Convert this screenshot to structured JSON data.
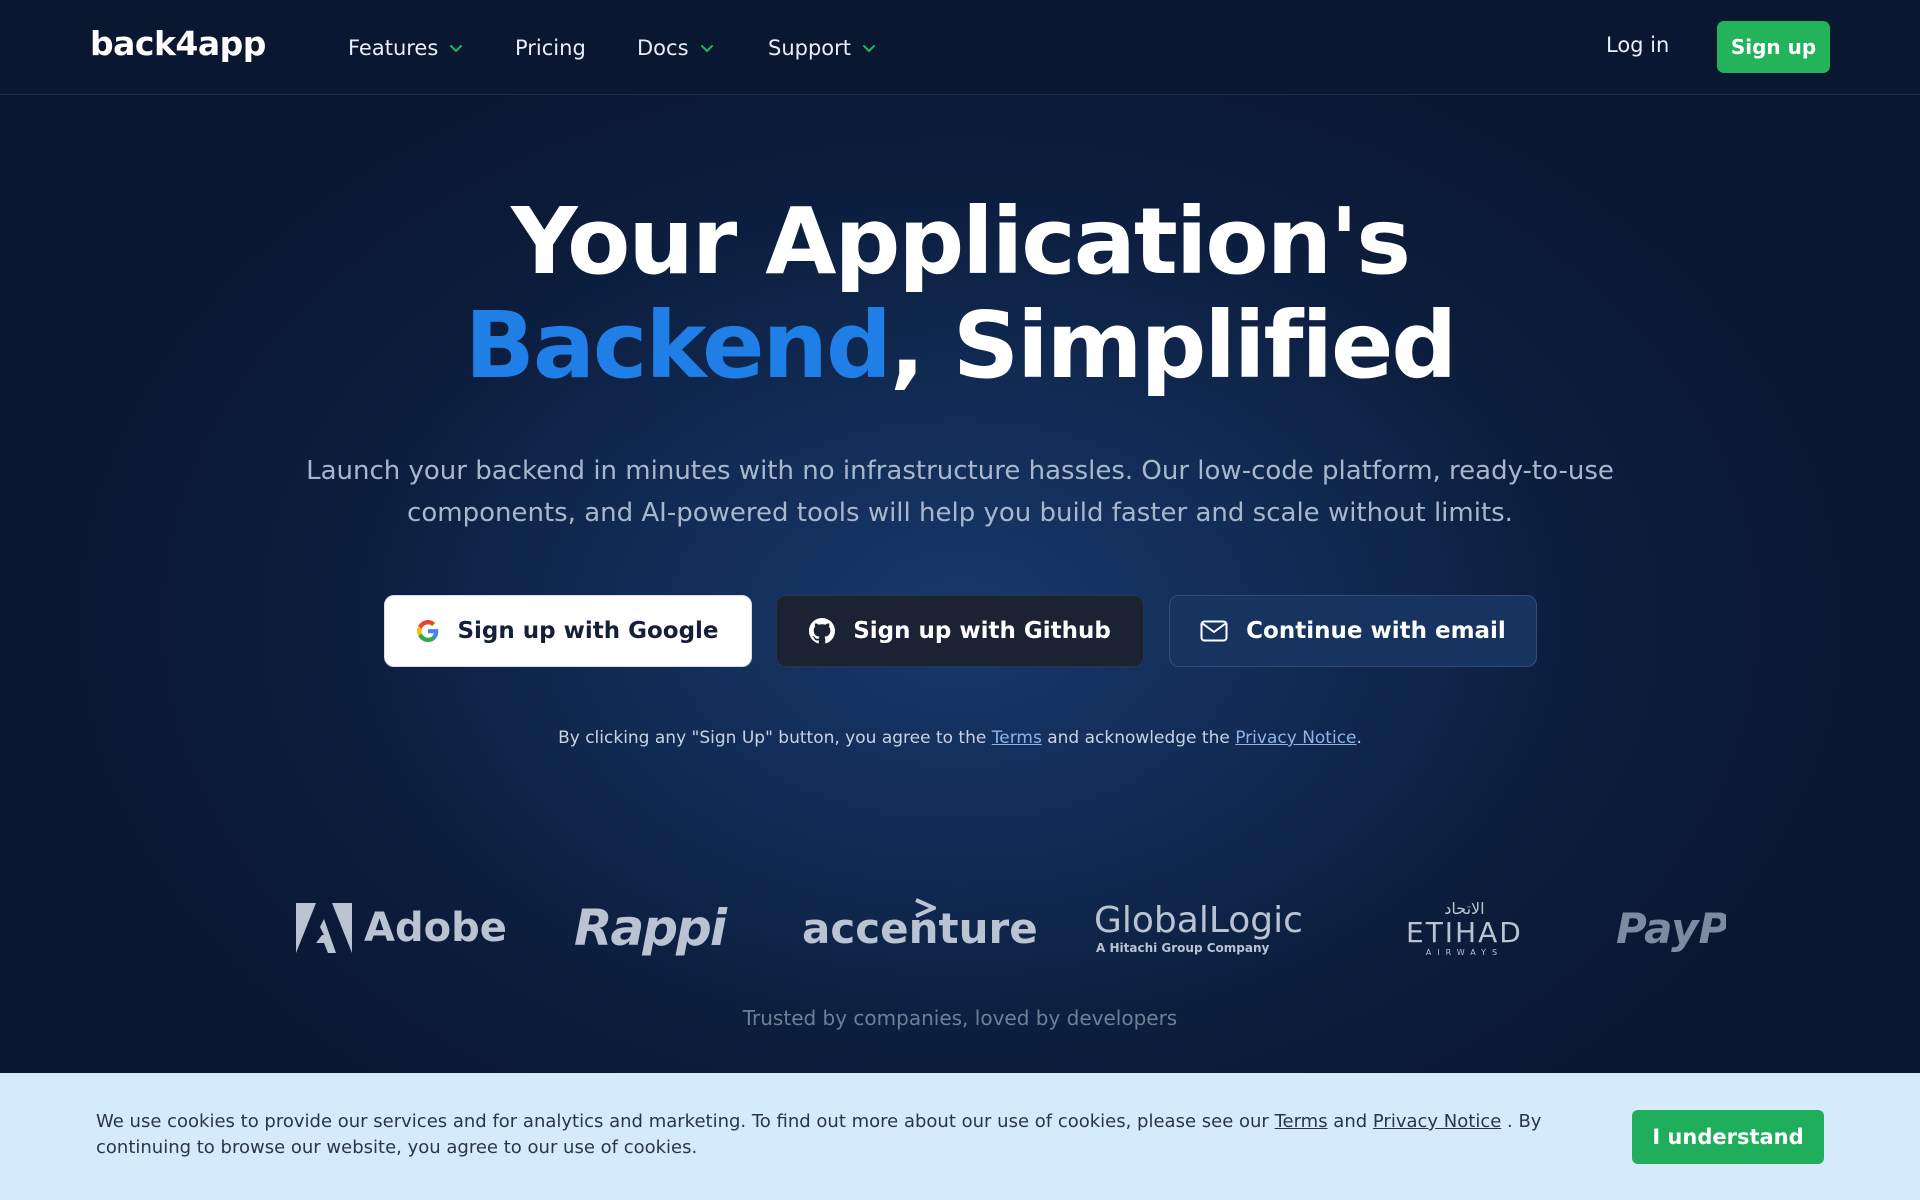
{
  "nav": {
    "logo": "back4app",
    "items": [
      {
        "label": "Features",
        "has_dropdown": true
      },
      {
        "label": "Pricing",
        "has_dropdown": false
      },
      {
        "label": "Docs",
        "has_dropdown": true
      },
      {
        "label": "Support",
        "has_dropdown": true
      }
    ],
    "login": "Log in",
    "signup": "Sign up"
  },
  "hero": {
    "title_line1": "Your Application's",
    "title_accent": "Backend",
    "title_line2_rest": ", Simplified",
    "subtitle": "Launch your backend in minutes with no infrastructure hassles. Our low-code platform, ready-to-use components, and AI-powered tools will help you build faster and scale without limits.",
    "buttons": {
      "google": "Sign up with Google",
      "github": "Sign up with Github",
      "email": "Continue with email"
    },
    "legal": {
      "prefix": "By clicking any \"Sign Up\" button, you agree to the ",
      "terms": "Terms",
      "middle": " and acknowledge the ",
      "privacy": "Privacy Notice",
      "suffix": "."
    }
  },
  "logos": {
    "brands": [
      "Adobe",
      "Rappi",
      "accenture",
      "GlobalLogic",
      "A Hitachi Group Company",
      "ETIHAD",
      "الاتحاد",
      "AIRWAYS",
      "PayP"
    ],
    "tagline": "Trusted by companies, loved by developers"
  },
  "cookie": {
    "text_prefix": "We use cookies to provide our services and for analytics and marketing. To find out more about our use of cookies, please see our ",
    "terms": "Terms",
    "and": " and ",
    "privacy": "Privacy Notice",
    "text_suffix": " . By continuing to browse our website, you agree to our use of cookies.",
    "button": "I understand"
  },
  "colors": {
    "accent_blue": "#1f7fe6",
    "brand_green": "#22b35b",
    "navbar_bg": "#0a1730",
    "cookie_bg": "#d5ebfb"
  },
  "icons": {
    "google": "google-g-icon",
    "github": "github-octocat-icon",
    "email": "envelope-icon",
    "dropdown": "chevron-down-icon"
  }
}
